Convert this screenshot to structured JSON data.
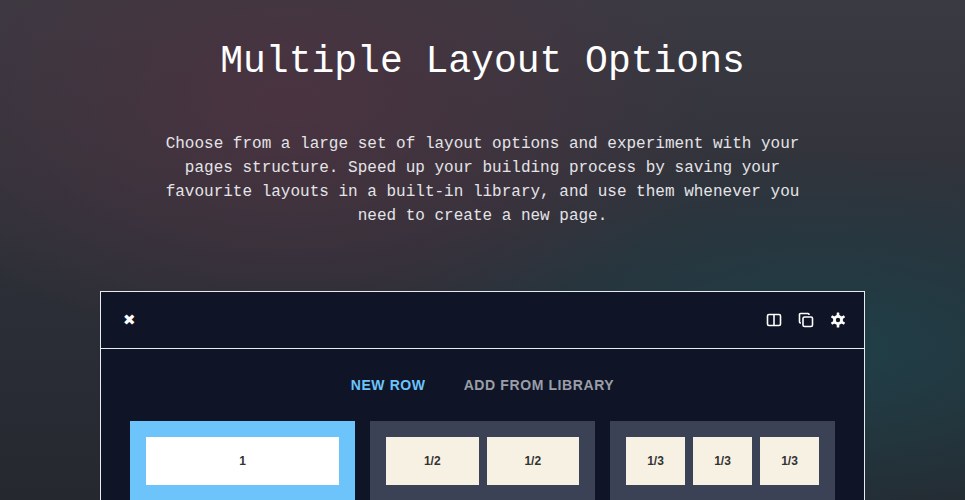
{
  "hero": {
    "title": "Multiple Layout Options",
    "description": "Choose from a large set of layout options and experiment with your pages structure. Speed up your building process by saving your favourite layouts in a built-in library, and use them whenever you need to create a new page."
  },
  "toolbar": {
    "close": "✖"
  },
  "tabs": [
    {
      "label": "NEW ROW",
      "selected": true
    },
    {
      "label": "ADD FROM LIBRARY",
      "selected": false
    }
  ],
  "layouts": [
    {
      "selected": true,
      "columns": [
        "1"
      ]
    },
    {
      "selected": false,
      "columns": [
        "1/2",
        "1/2"
      ]
    },
    {
      "selected": false,
      "columns": [
        "1/3",
        "1/3",
        "1/3"
      ]
    }
  ]
}
